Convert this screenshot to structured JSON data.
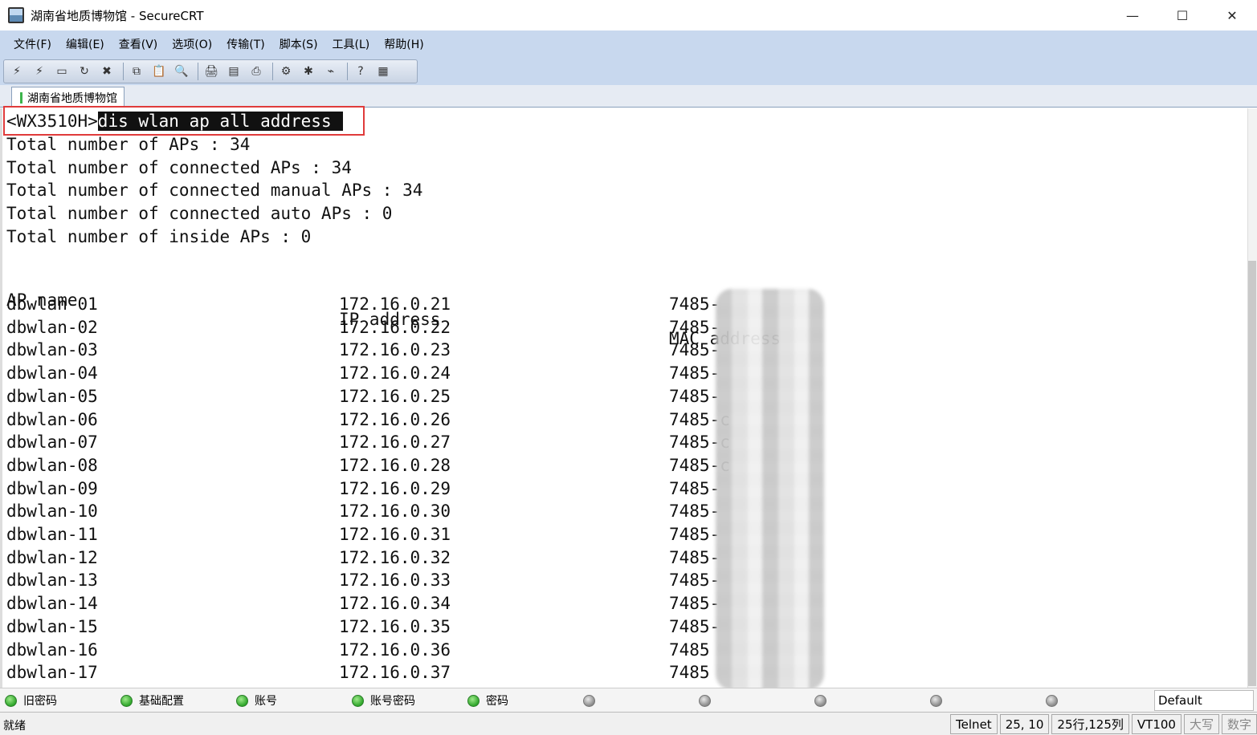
{
  "window": {
    "title": "湖南省地质博物馆 - SecureCRT",
    "minimize_glyph": "—",
    "maximize_glyph": "☐",
    "close_glyph": "✕"
  },
  "menu": [
    "文件(F)",
    "编辑(E)",
    "查看(V)",
    "选项(O)",
    "传输(T)",
    "脚本(S)",
    "工具(L)",
    "帮助(H)"
  ],
  "toolbar": {
    "icons": [
      "connect-icon",
      "quick-connect-icon",
      "connect-tab-icon",
      "reconnect-icon",
      "disconnect-icon",
      "copy-icon",
      "paste-icon",
      "find-icon",
      "print-icon",
      "print-selection-icon",
      "print-setup-icon",
      "session-options-icon",
      "global-options-icon",
      "keymap-icon",
      "help-icon",
      "sftp-icon"
    ],
    "glyphs": [
      "⚡",
      "⚡",
      "▭",
      "↻",
      "✖",
      "⧉",
      "📋",
      "🔍",
      "🖨",
      "▤",
      "⎙",
      "⚙",
      "✱",
      "⌁",
      "?",
      "▦"
    ]
  },
  "session_tab": "湖南省地质博物馆",
  "terminal": {
    "prompt": "<WX3510H>",
    "command": "dis wlan ap all address",
    "summary": [
      "Total number of APs : 34",
      "Total number of connected APs : 34",
      "Total number of connected manual APs : 34",
      "Total number of connected auto APs : 0",
      "Total number of inside APs : 0"
    ],
    "headers": [
      "AP name",
      "IP address",
      "MAC address"
    ],
    "rows": [
      {
        "name": "dbwlan-01",
        "ip": "172.16.0.21",
        "mac": "7485-"
      },
      {
        "name": "dbwlan-02",
        "ip": "172.16.0.22",
        "mac": "7485-"
      },
      {
        "name": "dbwlan-03",
        "ip": "172.16.0.23",
        "mac": "7485-"
      },
      {
        "name": "dbwlan-04",
        "ip": "172.16.0.24",
        "mac": "7485-"
      },
      {
        "name": "dbwlan-05",
        "ip": "172.16.0.25",
        "mac": "7485-"
      },
      {
        "name": "dbwlan-06",
        "ip": "172.16.0.26",
        "mac": "7485-c"
      },
      {
        "name": "dbwlan-07",
        "ip": "172.16.0.27",
        "mac": "7485-c"
      },
      {
        "name": "dbwlan-08",
        "ip": "172.16.0.28",
        "mac": "7485-c"
      },
      {
        "name": "dbwlan-09",
        "ip": "172.16.0.29",
        "mac": "7485-"
      },
      {
        "name": "dbwlan-10",
        "ip": "172.16.0.30",
        "mac": "7485-"
      },
      {
        "name": "dbwlan-11",
        "ip": "172.16.0.31",
        "mac": "7485-"
      },
      {
        "name": "dbwlan-12",
        "ip": "172.16.0.32",
        "mac": "7485-"
      },
      {
        "name": "dbwlan-13",
        "ip": "172.16.0.33",
        "mac": "7485-"
      },
      {
        "name": "dbwlan-14",
        "ip": "172.16.0.34",
        "mac": "7485-"
      },
      {
        "name": "dbwlan-15",
        "ip": "172.16.0.35",
        "mac": "7485-"
      },
      {
        "name": "dbwlan-16",
        "ip": "172.16.0.36",
        "mac": "7485"
      },
      {
        "name": "dbwlan-17",
        "ip": "172.16.0.37",
        "mac": "7485"
      }
    ]
  },
  "button_bar": {
    "buttons": [
      {
        "label": "旧密码",
        "status": "green"
      },
      {
        "label": "基础配置",
        "status": "green"
      },
      {
        "label": "账号",
        "status": "green"
      },
      {
        "label": "账号密码",
        "status": "green"
      },
      {
        "label": "密码",
        "status": "green"
      },
      {
        "label": "",
        "status": "gray"
      },
      {
        "label": "",
        "status": "gray"
      },
      {
        "label": "",
        "status": "gray"
      },
      {
        "label": "",
        "status": "gray"
      },
      {
        "label": "",
        "status": "gray"
      }
    ],
    "default_label": "Default"
  },
  "status": {
    "ready": "就绪",
    "protocol": "Telnet",
    "cursor": "25, 10",
    "size": "25行,125列",
    "emulation": "VT100",
    "caps": "大写",
    "num": "数字"
  },
  "colors": {
    "menu_bg": "#c8d8ee",
    "highlight_box": "#e03b3b",
    "status_green": "#2ea52a"
  }
}
